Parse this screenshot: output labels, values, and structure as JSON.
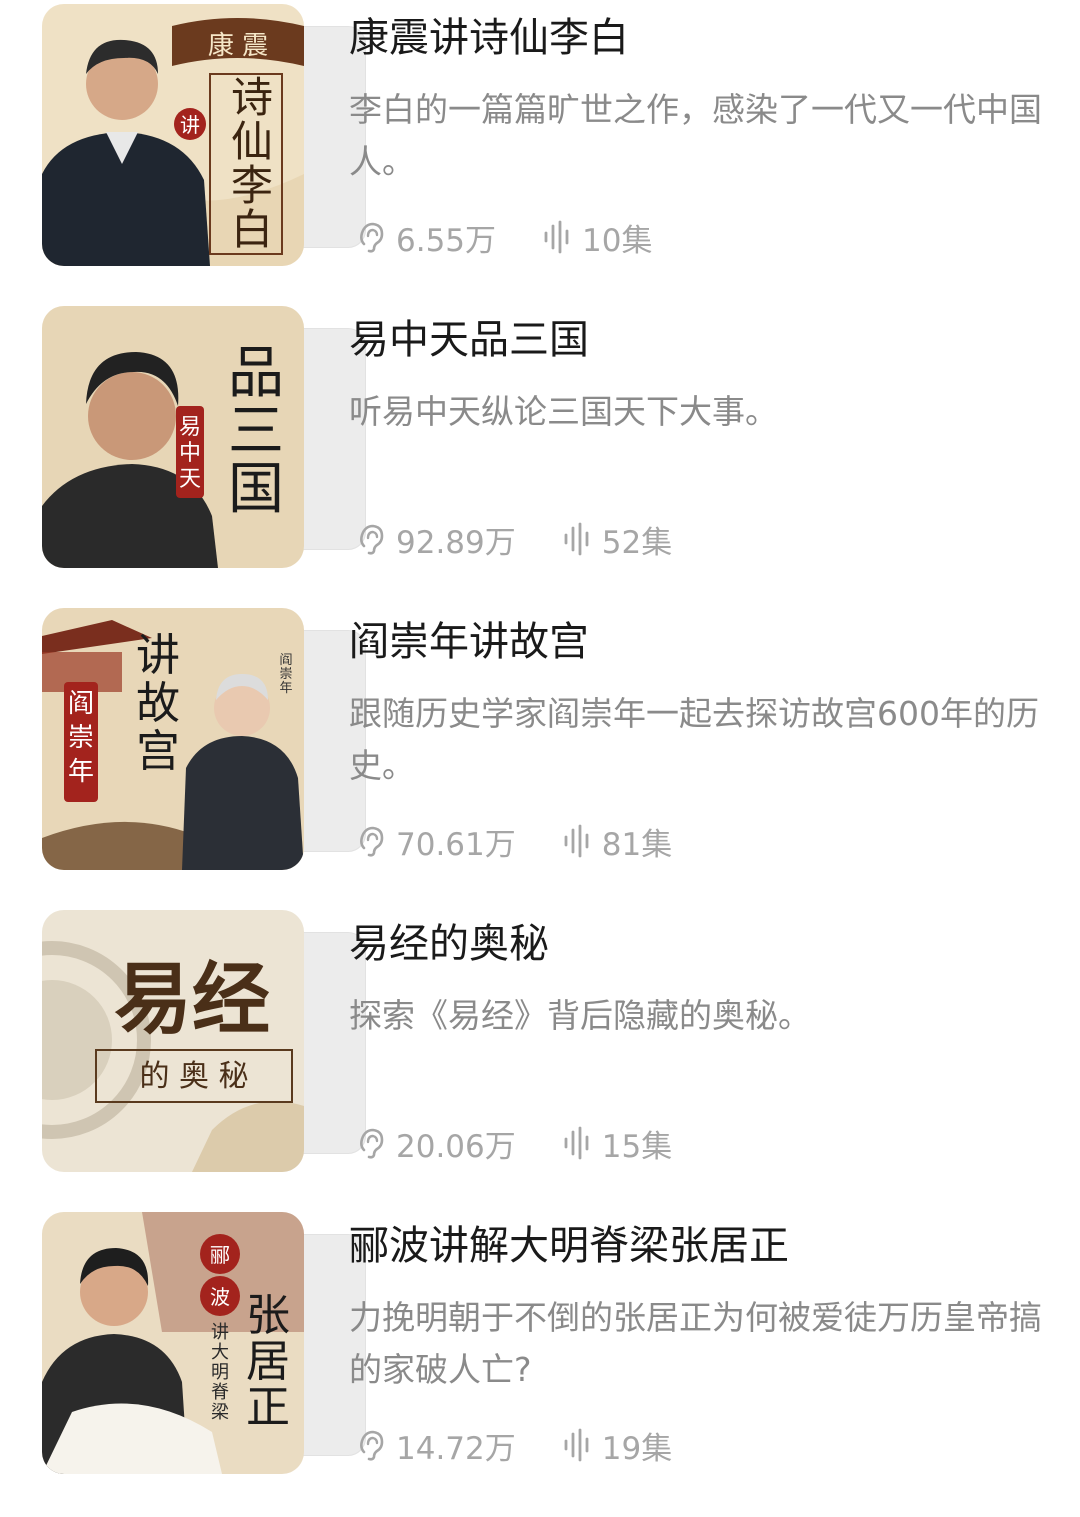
{
  "items": [
    {
      "title": "康震讲诗仙李白",
      "description": "李白的一篇篇旷世之作，感染了一代又一代中国人。",
      "plays": "6.55万",
      "episodes": "10集",
      "cover": {
        "scroll": "康 震",
        "side": "讲",
        "main": "诗仙李白",
        "bg": "#efe1c5"
      }
    },
    {
      "title": "易中天品三国",
      "description": "听易中天纵论三国天下大事。",
      "plays": "92.89万",
      "episodes": "52集",
      "cover": {
        "side": "易中天",
        "main": "品三国",
        "bg": "#e7d6b6"
      }
    },
    {
      "title": "阎崇年讲故宫",
      "description": "跟随历史学家阎崇年一起去探访故宫600年的历史。",
      "plays": "70.61万",
      "episodes": "81集",
      "cover": {
        "side": "阎崇年",
        "main": "讲故宫",
        "small": "阎崇年",
        "bg": "#e8d7b8"
      }
    },
    {
      "title": "易经的奥秘",
      "description": "探索《易经》背后隐藏的奥秘。",
      "plays": "20.06万",
      "episodes": "15集",
      "cover": {
        "main": "易经",
        "sub": "的 奥 秘",
        "bg": "#ece4d4"
      }
    },
    {
      "title": "郦波讲解大明脊梁张居正",
      "description": "力挽明朝于不倒的张居正为何被爱徒万历皇帝搞的家破人亡?",
      "plays": "14.72万",
      "episodes": "19集",
      "cover": {
        "side": "郦波",
        "sub": "讲大明脊梁",
        "main": "张居正",
        "bg": "#eadcc2"
      }
    }
  ],
  "icons": {
    "plays": "ear-icon",
    "episodes": "sound-wave-icon"
  },
  "colors": {
    "title": "#1a1a1a",
    "description": "#8a8a8a",
    "stats": "#a6a6a6",
    "seal": "#a3231d"
  }
}
